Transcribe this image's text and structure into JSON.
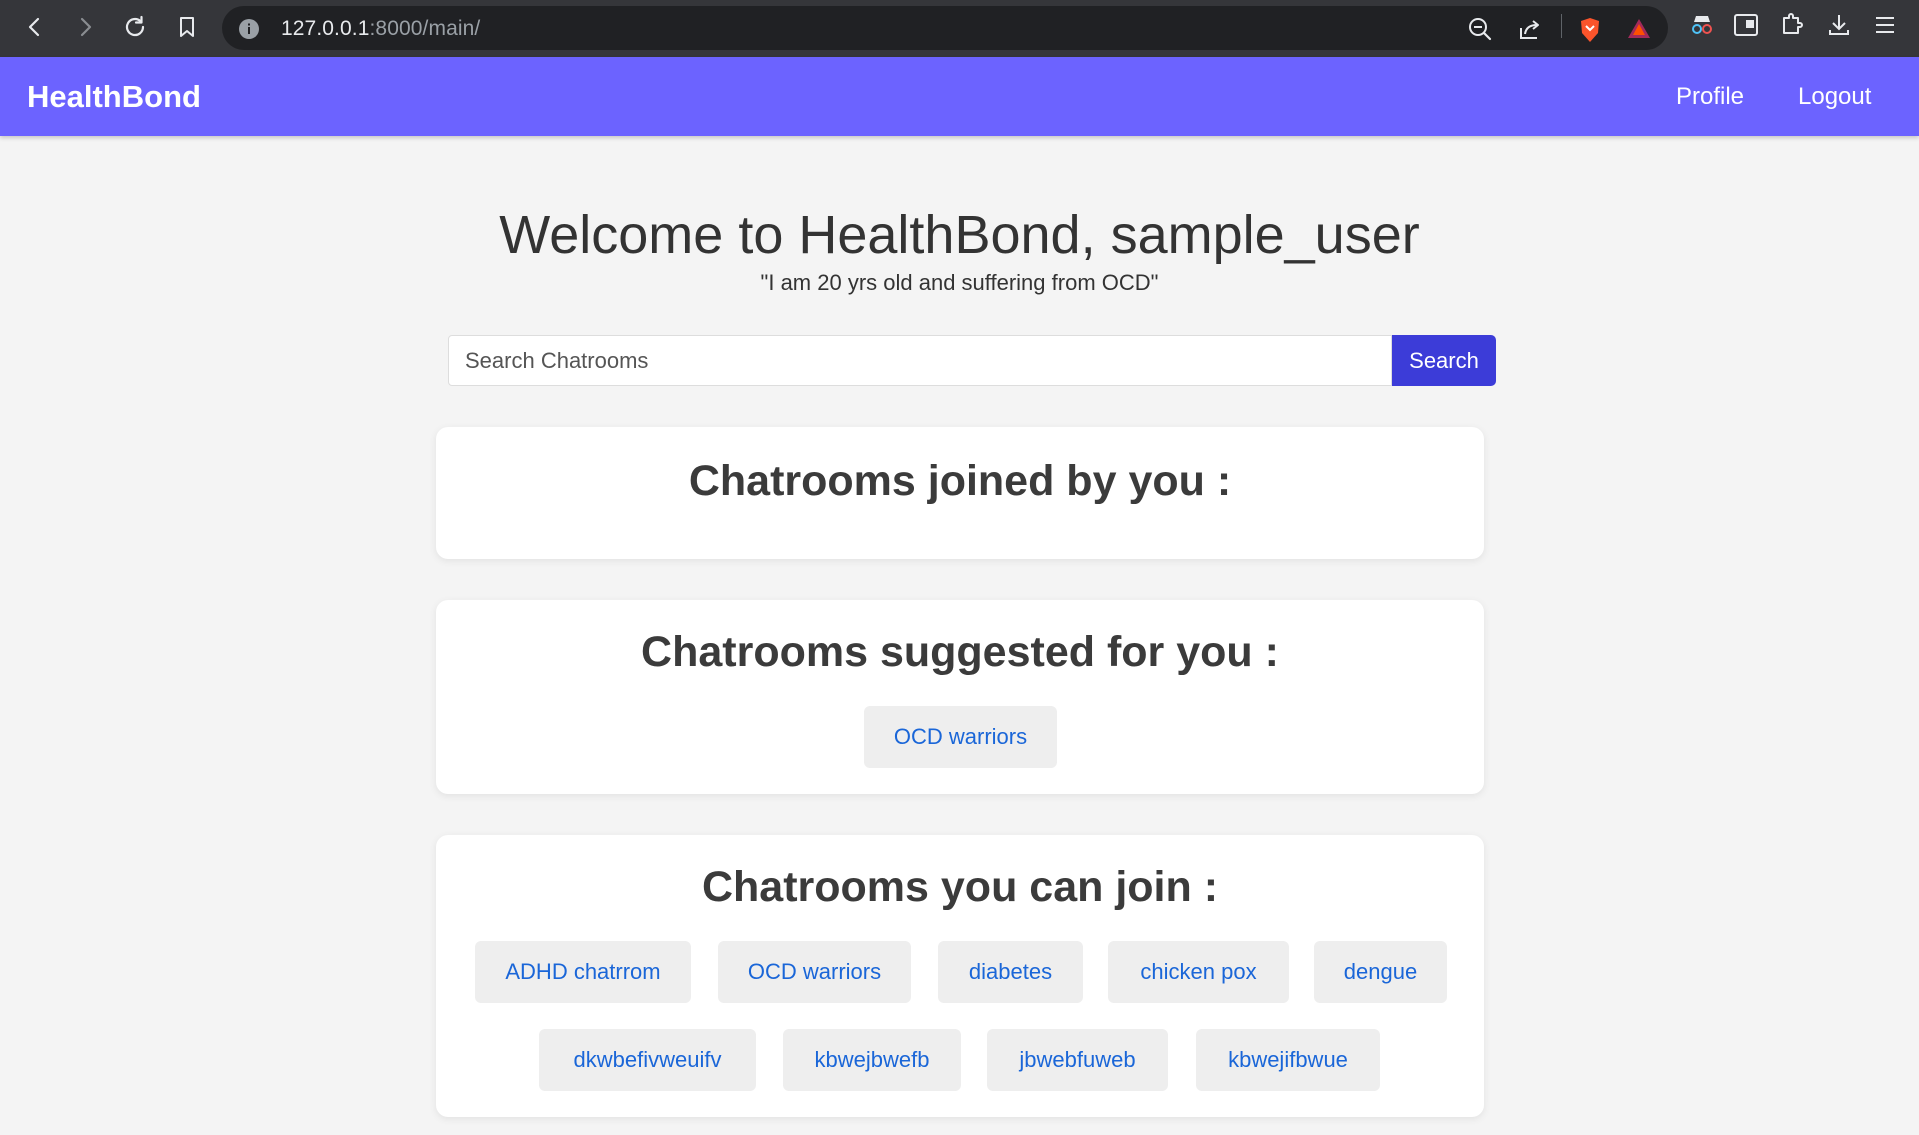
{
  "browser": {
    "url_host": "127.0.0.1",
    "url_path": ":8000/main/"
  },
  "navbar": {
    "brand": "HealthBond",
    "links": [
      {
        "label": "Profile"
      },
      {
        "label": "Logout"
      }
    ]
  },
  "main": {
    "welcome": "Welcome to HealthBond, sample_user",
    "bio": "\"I am 20 yrs old and suffering from OCD\"",
    "search": {
      "placeholder": "Search Chatrooms",
      "value": "",
      "button": "Search"
    },
    "sections": {
      "joined": {
        "title": "Chatrooms joined by you :",
        "rooms": []
      },
      "suggested": {
        "title": "Chatrooms suggested for you :",
        "rooms": [
          "OCD warriors"
        ]
      },
      "available": {
        "title": "Chatrooms you can join :",
        "rooms": [
          "ADHD chatrrom",
          "OCD warriors",
          "diabetes",
          "chicken pox",
          "dengue",
          "dkwbefivweuifv",
          "kbwejbwefb",
          "jbwebfuweb",
          "kbwejifbwue"
        ]
      }
    }
  },
  "colors": {
    "navbar": "#6c63ff",
    "search_button": "#3c3cd8",
    "room_link": "#1a66d8"
  }
}
